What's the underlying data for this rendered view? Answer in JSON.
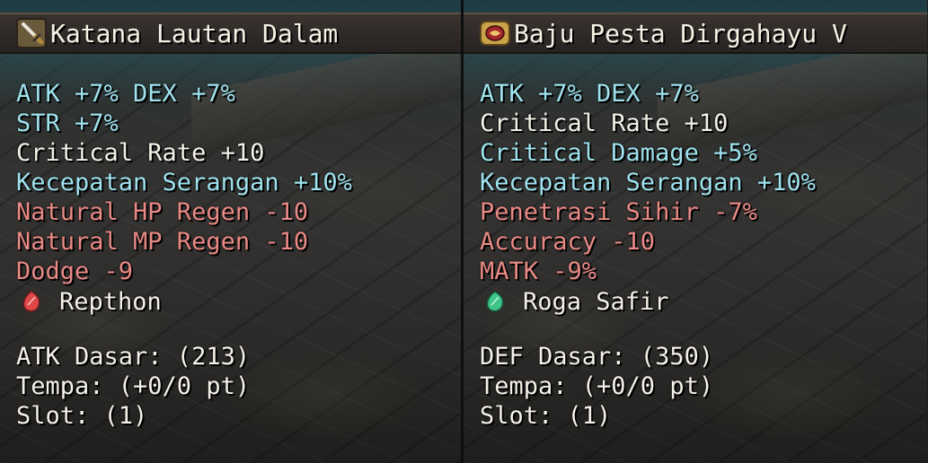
{
  "left": {
    "title": "Katana Lautan Dalam",
    "icon": "katana-icon",
    "stats": [
      {
        "text": "ATK +7% DEX +7%",
        "color": "cyan"
      },
      {
        "text": "STR +7%",
        "color": "cyan"
      },
      {
        "text": "Critical Rate +10",
        "color": "white"
      },
      {
        "text": "Kecepatan Serangan +10%",
        "color": "cyan"
      },
      {
        "text": "Natural HP Regen -10",
        "color": "red"
      },
      {
        "text": "Natural MP Regen -10",
        "color": "red"
      },
      {
        "text": "Dodge -9",
        "color": "red"
      }
    ],
    "gem": {
      "label": "Repthon",
      "icon": "red-gem-icon",
      "color": "#e0484a"
    },
    "base": [
      "ATK Dasar: (213)",
      "Tempa: (+0/0 pt)",
      "Slot: (1)"
    ]
  },
  "right": {
    "title": "Baju Pesta Dirgahayu V",
    "icon": "party-outfit-icon",
    "stats": [
      {
        "text": "ATK +7% DEX +7%",
        "color": "cyan"
      },
      {
        "text": "Critical Rate +10",
        "color": "white"
      },
      {
        "text": "Critical Damage +5%",
        "color": "cyan"
      },
      {
        "text": "Kecepatan Serangan +10%",
        "color": "cyan"
      },
      {
        "text": "Penetrasi Sihir -7%",
        "color": "red"
      },
      {
        "text": "Accuracy -10",
        "color": "red"
      },
      {
        "text": "MATK -9%",
        "color": "red"
      }
    ],
    "gem": {
      "label": "Roga Safir",
      "icon": "green-gem-icon",
      "color": "#3fc48a"
    },
    "base": [
      "DEF Dasar: (350)",
      "Tempa: (+0/0 pt)",
      "Slot: (1)"
    ]
  },
  "colors": {
    "cyan": "#9fe2ee",
    "white": "#f4f1e8",
    "red": "#e98a86"
  }
}
